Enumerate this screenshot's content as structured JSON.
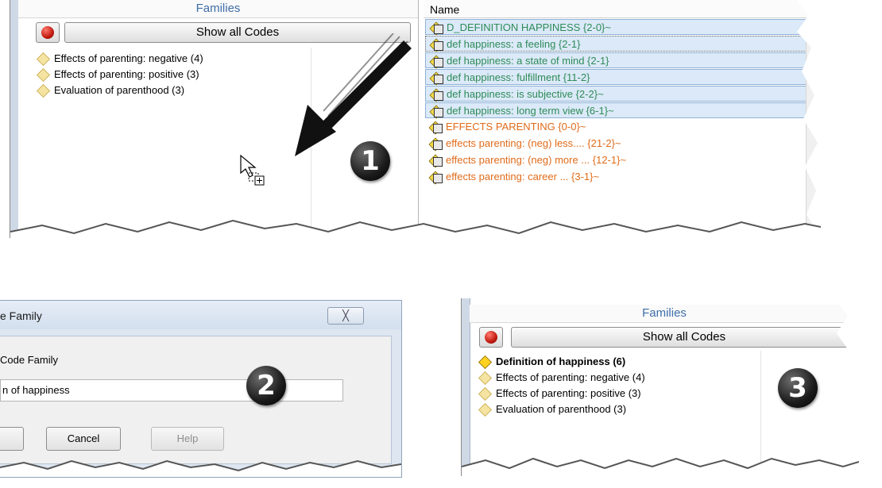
{
  "panel1": {
    "families": {
      "header": "Families",
      "show_all_label": "Show all Codes",
      "items": [
        {
          "label": "Effects of parenting: negative (4)"
        },
        {
          "label": "Effects of parenting: positive (3)"
        },
        {
          "label": "Evaluation of parenthood (3)"
        }
      ]
    },
    "codes": {
      "column_header": "Name",
      "items": [
        {
          "label": "D_DEFINITION HAPPINESS {2-0}~",
          "color": "green",
          "selected": true
        },
        {
          "label": "def happiness: a feeling {2-1}",
          "color": "green",
          "selected": true
        },
        {
          "label": "def happiness: a state of mind {2-1}",
          "color": "green",
          "selected": true
        },
        {
          "label": "def happiness: fulfillment {11-2}",
          "color": "green",
          "selected": true
        },
        {
          "label": "def happiness: is subjective {2-2}~",
          "color": "green",
          "selected": true
        },
        {
          "label": "def happiness: long term view {6-1}~",
          "color": "green",
          "selected": true
        },
        {
          "label": "EFFECTS PARENTING {0-0}~",
          "color": "orange",
          "selected": false
        },
        {
          "label": "effects parenting: (neg) less.... {21-2}~",
          "color": "orange",
          "selected": false
        },
        {
          "label": "effects parenting: (neg) more ... {12-1}~",
          "color": "orange",
          "selected": false
        },
        {
          "label": "effects parenting: career ... {3-1}~",
          "color": "orange",
          "selected": false
        }
      ]
    },
    "step_number": "1"
  },
  "panel2": {
    "title": "e Family",
    "close_symbol": "╳",
    "label": "Code Family",
    "input_value": "n of happiness",
    "cancel_label": "Cancel",
    "help_label": "Help",
    "step_number": "2"
  },
  "panel3": {
    "families": {
      "header": "Families",
      "show_all_label": "Show all Codes",
      "items": [
        {
          "label": "Definition of happiness (6)",
          "bold": true
        },
        {
          "label": "Effects of parenting: negative (4)",
          "bold": false
        },
        {
          "label": "Effects of parenting: positive (3)",
          "bold": false
        },
        {
          "label": "Evaluation of parenthood (3)",
          "bold": false
        }
      ]
    },
    "step_number": "3"
  },
  "colors": {
    "family_header": "#3f6ea8",
    "code_green": "#2e8b57",
    "code_orange": "#e06b1a",
    "selection_bg": "#dbe9f8"
  },
  "icons": {
    "family": "family-diamond-icon",
    "code": "code-family-icon",
    "record": "red-record-icon",
    "cursor": "drag-copy-cursor-icon",
    "arrow": "drag-direction-arrow-icon"
  }
}
